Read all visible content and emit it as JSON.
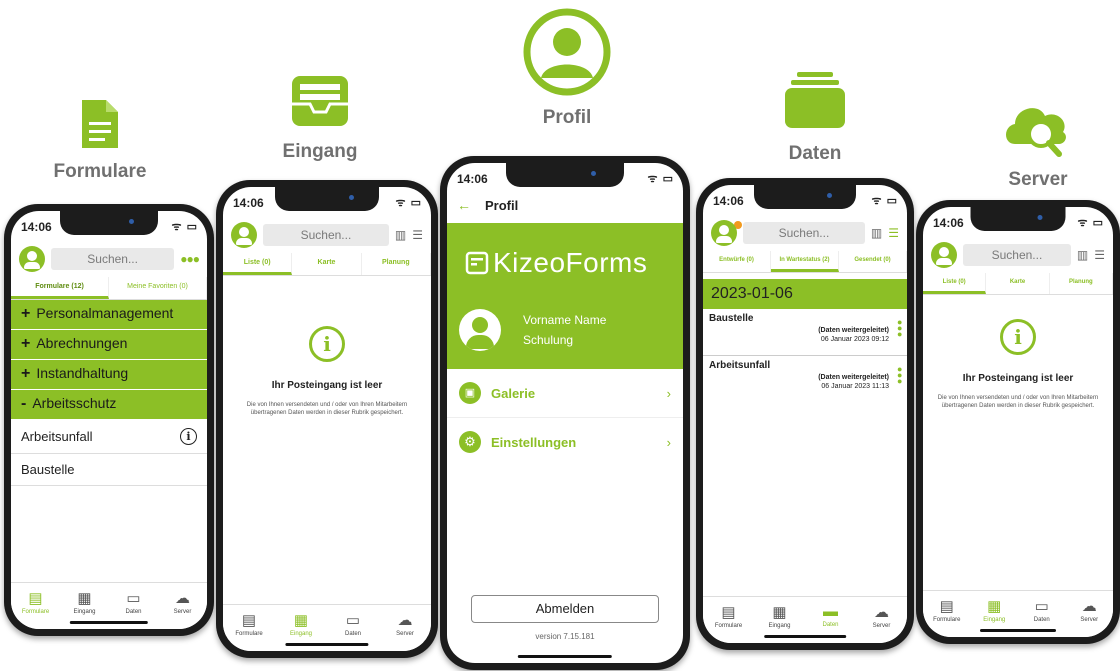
{
  "headers": {
    "formulare": "Formulare",
    "eingang": "Eingang",
    "profil": "Profil",
    "daten": "Daten",
    "server": "Server"
  },
  "common": {
    "time": "14:06",
    "search_placeholder": "Suchen...",
    "system_icons": "ᯤ ▭",
    "tabbar": {
      "formulare": "Formulare",
      "eingang": "Eingang",
      "daten": "Daten",
      "server": "Server"
    }
  },
  "formulare_screen": {
    "tab_forms": "Formulare (12)",
    "tab_favorites": "Meine Favoriten (0)",
    "categories": [
      {
        "sign": "+",
        "label": "Personalmanagement"
      },
      {
        "sign": "+",
        "label": "Abrechnungen"
      },
      {
        "sign": "+",
        "label": "Instandhaltung"
      },
      {
        "sign": "-",
        "label": "Arbeitsschutz"
      }
    ],
    "items": [
      "Arbeitsunfall",
      "Baustelle"
    ]
  },
  "eingang_screen": {
    "tabs": [
      "Liste (0)",
      "Karte",
      "Planung"
    ],
    "empty_title": "Ihr Posteingang ist leer",
    "empty_desc": "Die von Ihnen versendeten und / oder von Ihren Mitarbeitern übertragenen Daten werden in dieser Rubrik gespeichert."
  },
  "profil_screen": {
    "title": "Profil",
    "brand": "KizeoForms",
    "user_name": "Vorname Name",
    "user_group": "Schulung",
    "menu": [
      "Galerie",
      "Einstellungen"
    ],
    "logout": "Abmelden",
    "version": "version 7.15.181"
  },
  "daten_screen": {
    "tabs": [
      "Entwürfe (0)",
      "In Wartestatus (2)",
      "Gesendet (0)"
    ],
    "date": "2023-01-06",
    "entries": [
      {
        "name": "Baustelle",
        "status": "(Daten weitergeleitet)",
        "when": "06 Januar 2023 09:12"
      },
      {
        "name": "Arbeitsunfall",
        "status": "(Daten weitergeleitet)",
        "when": "06 Januar 2023 11:13"
      }
    ]
  },
  "accent_color": "#8cbf26"
}
